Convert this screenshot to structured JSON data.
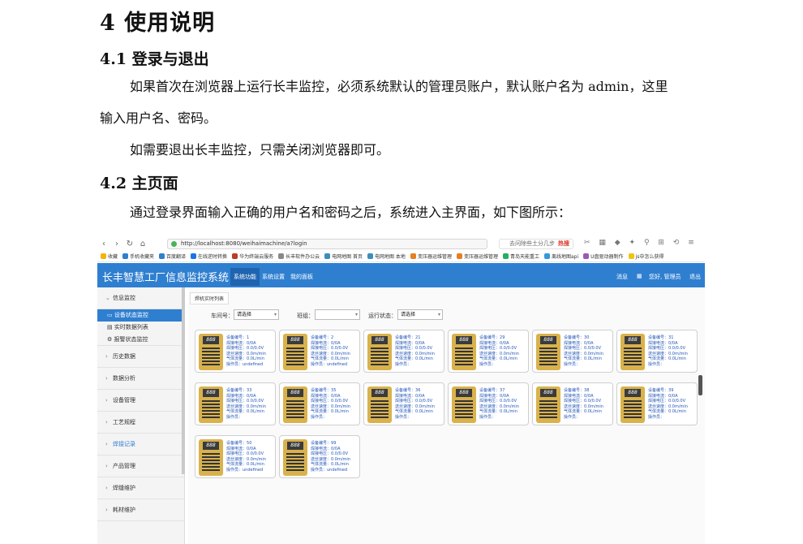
{
  "doc": {
    "h1": "4  使用说明",
    "h2_login": "4.1  登录与退出",
    "p1": "如果首次在浏览器上运行长丰监控，必须系统默认的管理员账户，默认账户名为 admin，这里",
    "p1b": "输入用户名、密码。",
    "p2": "如需要退出长丰监控，只需关闭浏览器即可。",
    "h2_main": "4.2 主页面",
    "p3": "通过登录界面输入正确的用户名和密码之后，系统进入主界面，如下图所示："
  },
  "browser": {
    "url": "http://localhost:8080/weihaimachine/a?login",
    "search_placeholder": "去问除些土分几步",
    "hot": "热搜",
    "bookmarks": [
      "收藏",
      "手机收藏夹",
      "百度翻译",
      "在线逆时转换",
      "华为终端云服务",
      "长丰软件办公云",
      "电网地图 首页",
      "电网地图 本地",
      "变压器运维管理",
      "变压器运维管理",
      "青岛天能重工",
      "离线地图api",
      "U盘驱动器制作",
      "js中怎么获得"
    ]
  },
  "app": {
    "title": "长丰智慧工厂信息监控系统",
    "tabs": [
      "系统功能",
      "系统设置",
      "我的面板"
    ],
    "header_right": [
      "消息",
      "您好, 管理员",
      "退出"
    ]
  },
  "sidebar": {
    "groups": [
      {
        "label": "信息监控",
        "expanded": true,
        "items": [
          "设备状态监控",
          "实时数据列表",
          "报警状态监控"
        ]
      },
      {
        "label": "历史数据"
      },
      {
        "label": "数据分析"
      },
      {
        "label": "设备管理"
      },
      {
        "label": "工艺规程"
      },
      {
        "label": "焊接记录"
      },
      {
        "label": "产品管理"
      },
      {
        "label": "焊缝维护"
      },
      {
        "label": "耗材维护"
      }
    ]
  },
  "content": {
    "tab": "焊机实时列表",
    "filters": {
      "workshop_label": "车间号：",
      "workshop_value": "请选择",
      "team_label": "班组：",
      "team_value": "",
      "status_label": "运行状态：",
      "status_value": "请选择"
    }
  },
  "devices": [
    {
      "id": "1",
      "v": "0.0/0.0V",
      "speed": "0.0m/min",
      "gas": "0.0L/min",
      "op": "undefined"
    },
    {
      "id": "2",
      "v": "0.0/0.0V",
      "speed": "0.0m/min",
      "gas": "0.0L/min",
      "op": "undefined"
    },
    {
      "id": "21",
      "v": "0.0/0.0V",
      "speed": "0.0m/min",
      "gas": "0.0L/min",
      "op": ""
    },
    {
      "id": "29",
      "v": "0.0/0.0V",
      "speed": "0.0m/min",
      "gas": "0.0L/min",
      "op": ""
    },
    {
      "id": "30",
      "v": "0.0/0.0V",
      "speed": "0.0m/min",
      "gas": "0.0L/min",
      "op": ""
    },
    {
      "id": "31",
      "v": "0.0/0.0V",
      "speed": "0.0m/min",
      "gas": "0.0L/min",
      "op": ""
    },
    {
      "id": "33",
      "v": "0.0/0.0V",
      "speed": "0.0m/min",
      "gas": "0.0L/min",
      "op": ""
    },
    {
      "id": "35",
      "v": "0.0/0.0V",
      "speed": "0.0m/min",
      "gas": "0.0L/min",
      "op": ""
    },
    {
      "id": "36",
      "v": "0.0/0.0V",
      "speed": "0.0m/min",
      "gas": "0.0L/min",
      "op": ""
    },
    {
      "id": "37",
      "v": "0.0/0.0V",
      "speed": "0.0m/min",
      "gas": "0.0L/min",
      "op": ""
    },
    {
      "id": "38",
      "v": "0.0/0.0V",
      "speed": "0.0m/min",
      "gas": "0.0L/min",
      "op": ""
    },
    {
      "id": "39",
      "v": "0.0/0.0V",
      "speed": "0.0m/min",
      "gas": "0.0L/min",
      "op": ""
    },
    {
      "id": "50",
      "v": "0.0/0.0V",
      "speed": "0.0m/min",
      "gas": "0.0L/min",
      "op": "undefined"
    },
    {
      "id": "99",
      "v": "0.0/0.0V",
      "speed": "0.0m/min",
      "gas": "0.0L/min",
      "op": "undefined"
    }
  ],
  "device_labels": {
    "id": "设备编号：",
    "current": "焊接电流：",
    "current_val": "0/0A",
    "voltage": "焊接电压：",
    "speed": "送丝速度：",
    "gas": "气体流量：",
    "op": "操作员：",
    "screen": "888"
  }
}
